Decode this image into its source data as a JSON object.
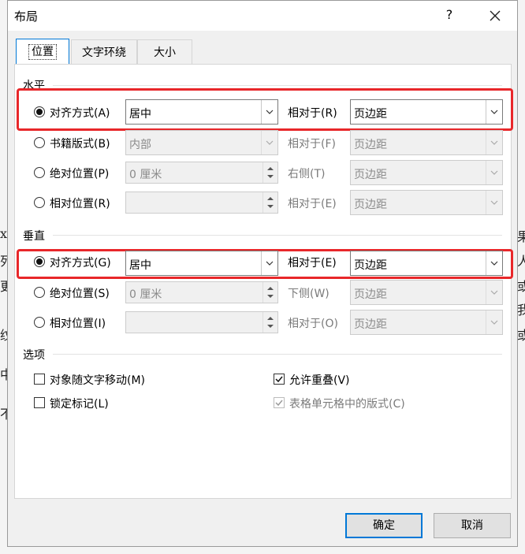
{
  "dialog": {
    "title": "布局",
    "help_label": "?",
    "close_icon": "close-icon"
  },
  "tabs": [
    {
      "label": "位置",
      "active": true
    },
    {
      "label": "文字环绕",
      "active": false
    },
    {
      "label": "大小",
      "active": false
    }
  ],
  "horizontal": {
    "section_title": "水平",
    "rows": [
      {
        "label": "对齐方式(A)",
        "selected": true,
        "enabled": true,
        "value": "居中",
        "rel_label": "相对于(R)",
        "rel_value": "页边距"
      },
      {
        "label": "书籍版式(B)",
        "selected": false,
        "enabled": false,
        "value": "内部",
        "rel_label": "相对于(F)",
        "rel_value": "页边距"
      },
      {
        "label": "绝对位置(P)",
        "selected": false,
        "enabled": false,
        "value": "0 厘米",
        "rel_label": "右侧(T)",
        "rel_value": "页边距"
      },
      {
        "label": "相对位置(R)",
        "selected": false,
        "enabled": false,
        "value": "",
        "rel_label": "相对于(E)",
        "rel_value": "页边距"
      }
    ]
  },
  "vertical": {
    "section_title": "垂直",
    "rows": [
      {
        "label": "对齐方式(G)",
        "selected": true,
        "enabled": true,
        "value": "居中",
        "rel_label": "相对于(E)",
        "rel_value": "页边距"
      },
      {
        "label": "绝对位置(S)",
        "selected": false,
        "enabled": false,
        "value": "0 厘米",
        "rel_label": "下侧(W)",
        "rel_value": "页边距"
      },
      {
        "label": "相对位置(I)",
        "selected": false,
        "enabled": false,
        "value": "",
        "rel_label": "相对于(O)",
        "rel_value": "页边距"
      }
    ]
  },
  "options": {
    "section_title": "选项",
    "move_with_text": {
      "label": "对象随文字移动(M)",
      "checked": false,
      "enabled": true
    },
    "lock_anchor": {
      "label": "锁定标记(L)",
      "checked": false,
      "enabled": true
    },
    "allow_overlap": {
      "label": "允许重叠(V)",
      "checked": true,
      "enabled": true
    },
    "layout_in_cell": {
      "label": "表格单元格中的版式(C)",
      "checked": true,
      "enabled": false
    }
  },
  "footer": {
    "ok_label": "确定",
    "cancel_label": "取消"
  },
  "background": {
    "left_glyphs": [
      "x",
      "列",
      "更",
      "纹",
      "中",
      "不"
    ],
    "right_glyphs": [
      "果",
      "人",
      "或",
      "我",
      "或"
    ]
  },
  "colors": {
    "highlight": "#e8272a",
    "accent": "#0078d7"
  }
}
